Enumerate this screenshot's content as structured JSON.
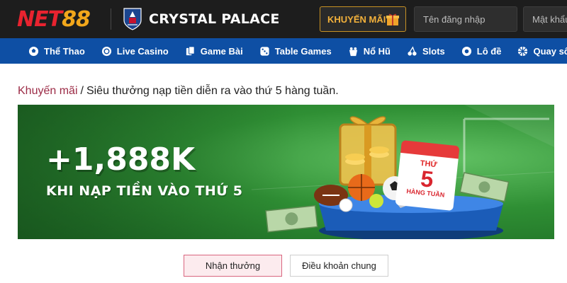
{
  "header": {
    "logo_text_a": "NET",
    "logo_text_b": "88",
    "club_name": "CRYSTAL PALACE",
    "promo_button": "KHUYẾN MÃI",
    "username_placeholder": "Tên đăng nhập",
    "password_placeholder": "Mật khẩu",
    "colors": {
      "brand_red": "#e8232f",
      "brand_gold": "#f2a71b",
      "nav_blue": "#0e4fa4"
    }
  },
  "nav": {
    "items": [
      {
        "label": "Thể Thao",
        "icon": "soccer-ball-icon"
      },
      {
        "label": "Live Casino",
        "icon": "casino-chip-icon"
      },
      {
        "label": "Game Bài",
        "icon": "cards-icon"
      },
      {
        "label": "Table Games",
        "icon": "dice-icon"
      },
      {
        "label": "Nổ Hũ",
        "icon": "slot-pot-icon"
      },
      {
        "label": "Slots",
        "icon": "cherries-icon"
      },
      {
        "label": "Lô đề",
        "icon": "lottery-ball-icon"
      },
      {
        "label": "Quay số",
        "icon": "wheel-icon"
      }
    ]
  },
  "breadcrumb": {
    "parent": "Khuyến mãi",
    "separator": "/",
    "current": "Siêu thưởng nạp tiền diễn ra vào thứ 5 hàng tuần."
  },
  "banner": {
    "amount": "+1,888K",
    "subline": "KHI NẠP TIỀN VÀO THỨ 5",
    "calendar_day_label": "THỨ",
    "calendar_number": "5",
    "calendar_sub": "HÀNG TUẦN"
  },
  "tabs": {
    "claim": "Nhận thưởng",
    "terms": "Điều khoản chung"
  }
}
